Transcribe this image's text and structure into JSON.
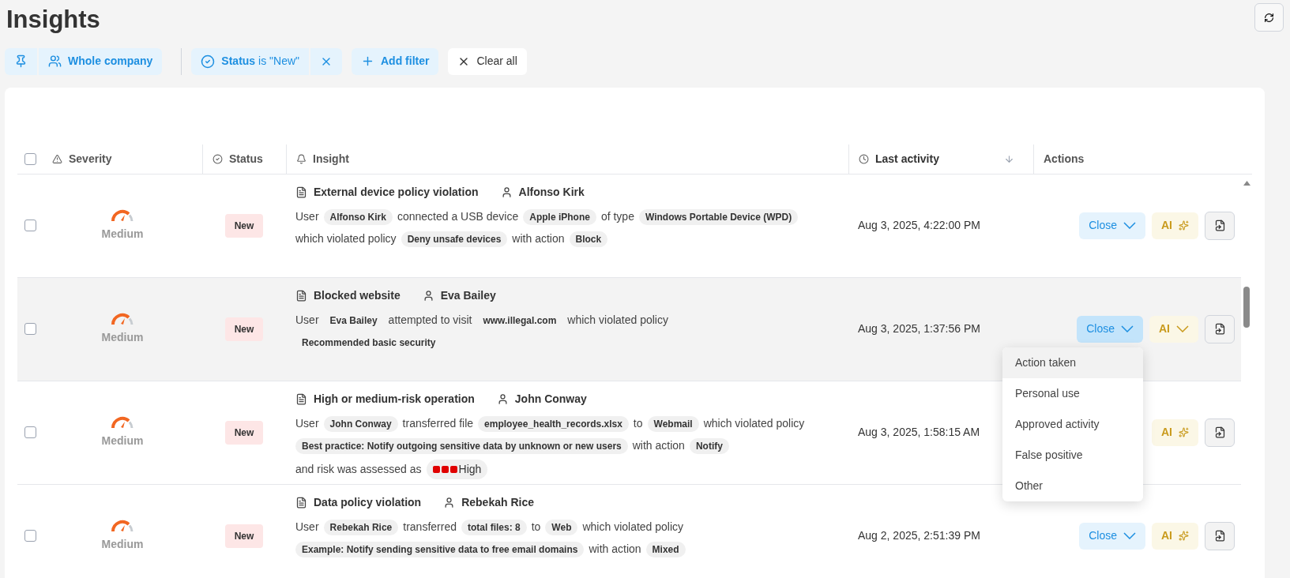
{
  "page": {
    "title": "Insights"
  },
  "filters": [
    {
      "kind": "pin"
    },
    {
      "kind": "scope",
      "label": "Whole company"
    },
    {
      "kind": "status",
      "label": "**Status** is \"New\""
    },
    {
      "kind": "add",
      "label": "Add filter"
    },
    {
      "kind": "clear",
      "label": "Clear all"
    }
  ],
  "table": {
    "select_all": {
      "checked": false
    },
    "columns": [
      {
        "kind": "severity",
        "label": "Severity"
      },
      {
        "kind": "status",
        "label": "Status"
      },
      {
        "kind": "insight",
        "label": "Insight"
      },
      {
        "kind": "date",
        "label": "Last activity",
        "sorted": true
      },
      {
        "kind": "actions",
        "label": "Actions"
      }
    ],
    "rows": [
      {
        "checked": false,
        "hovered": false,
        "severity": "Medium",
        "status": "New",
        "title": "External device policy violation",
        "user": "Alfonso Kirk",
        "lines": [
          [
            {
              "kind": "text",
              "text": "User"
            },
            {
              "kind": "chip",
              "text": "Alfonso Kirk"
            },
            {
              "kind": "text",
              "text": "connected a USB device"
            },
            {
              "kind": "chip",
              "text": "Apple iPhone"
            },
            {
              "kind": "text",
              "text": "of type"
            },
            {
              "kind": "chip",
              "text": "Windows Portable Device (WPD)"
            }
          ],
          [
            {
              "kind": "text",
              "text": "which violated policy"
            },
            {
              "kind": "chip",
              "text": "Deny unsafe devices"
            },
            {
              "kind": "text",
              "text": "with action"
            },
            {
              "kind": "chip",
              "text": "Block"
            }
          ]
        ],
        "date": "Aug 3, 2025, 4:22:00 PM",
        "actions": [
          {
            "kind": "close",
            "label": "Close",
            "pressed": false
          },
          {
            "kind": "ai",
            "label": "AI",
            "hovered": false
          },
          {
            "kind": "export"
          }
        ]
      },
      {
        "checked": false,
        "hovered": true,
        "severity": "Medium",
        "status": "New",
        "title": "Blocked website",
        "user": "Eva Bailey",
        "lines": [
          [
            {
              "kind": "text",
              "text": "User"
            },
            {
              "kind": "chip",
              "text": "Eva Bailey"
            },
            {
              "kind": "text",
              "text": "attempted to visit"
            },
            {
              "kind": "chip",
              "text": "www.illegal.com"
            },
            {
              "kind": "text",
              "text": "which violated policy"
            }
          ],
          [
            {
              "kind": "chip",
              "text": "Recommended basic security"
            }
          ]
        ],
        "date": "Aug 3, 2025, 1:37:56 PM",
        "actions": [
          {
            "kind": "close",
            "label": "Close",
            "pressed": true
          },
          {
            "kind": "ai",
            "label": "AI",
            "hovered": true
          },
          {
            "kind": "export"
          }
        ],
        "menu": [
          {
            "label": "Action taken",
            "selected": true
          },
          {
            "label": "Personal use",
            "selected": false
          },
          {
            "label": "Approved activity",
            "selected": false
          },
          {
            "label": "False positive",
            "selected": false
          },
          {
            "label": "Other",
            "selected": false
          }
        ]
      },
      {
        "checked": false,
        "hovered": false,
        "severity": "Medium",
        "status": "New",
        "title": "High or medium-risk operation",
        "user": "John Conway",
        "lines": [
          [
            {
              "kind": "text",
              "text": "User"
            },
            {
              "kind": "chip",
              "text": "John Conway"
            },
            {
              "kind": "text",
              "text": "transferred file"
            },
            {
              "kind": "chip",
              "text": "employee_health_records.xlsx"
            },
            {
              "kind": "text",
              "text": "to"
            },
            {
              "kind": "chip",
              "text": "Webmail"
            },
            {
              "kind": "text",
              "text": "which violated policy"
            }
          ],
          [
            {
              "kind": "chip",
              "text": "Best practice: Notify outgoing sensitive data by unknown or new users"
            },
            {
              "kind": "text",
              "text": "with action"
            },
            {
              "kind": "chip",
              "text": "Notify"
            }
          ],
          [
            {
              "kind": "text",
              "text": "and risk was assessed as"
            },
            {
              "kind": "risk",
              "text": "High"
            }
          ]
        ],
        "date": "Aug 3, 2025, 1:58:15 AM",
        "actions": [
          {
            "kind": "ai",
            "label": "AI",
            "hovered": false
          },
          {
            "kind": "export"
          }
        ]
      },
      {
        "checked": false,
        "hovered": false,
        "severity": "Medium",
        "status": "New",
        "title": "Data policy violation",
        "user": "Rebekah Rice",
        "lines": [
          [
            {
              "kind": "text",
              "text": "User"
            },
            {
              "kind": "chip",
              "text": "Rebekah Rice"
            },
            {
              "kind": "text",
              "text": "transferred"
            },
            {
              "kind": "chip",
              "text": "total files: 8"
            },
            {
              "kind": "text",
              "text": "to"
            },
            {
              "kind": "chip",
              "text": "Web"
            },
            {
              "kind": "text",
              "text": "which violated policy"
            }
          ],
          [
            {
              "kind": "chip",
              "text": "Example: Notify sending sensitive data to free email domains"
            },
            {
              "kind": "text",
              "text": "with action"
            },
            {
              "kind": "chip",
              "text": "Mixed"
            }
          ]
        ],
        "date": "Aug 2, 2025, 2:51:39 PM",
        "actions": [
          {
            "kind": "close",
            "label": "Close",
            "pressed": false
          },
          {
            "kind": "ai",
            "label": "AI",
            "hovered": false
          },
          {
            "kind": "export"
          }
        ]
      }
    ]
  }
}
